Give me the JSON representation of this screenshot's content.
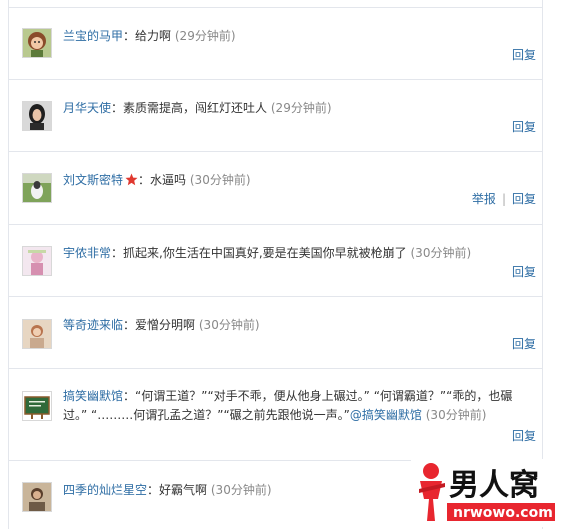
{
  "colors": {
    "link": "#2e6da4",
    "text": "#333333",
    "time": "#888888",
    "border": "#e3e6ec",
    "logo_red": "#e8262f"
  },
  "comments": [
    {
      "user": "兰宝的马甲",
      "text": "给力啊",
      "time": "(29分钟前)",
      "actions": [
        "回复"
      ],
      "avatar_icon": "cartoon-girl-avatar"
    },
    {
      "user": "月华天使",
      "text": "素质需提高，闯红灯还吐人",
      "time": "(29分钟前)",
      "actions": [
        "回复"
      ],
      "avatar_icon": "woman-photo-avatar"
    },
    {
      "user": "刘文斯密特",
      "badge_icon": "red-star-badge-icon",
      "text": "水逼吗",
      "time": "(30分钟前)",
      "actions": [
        "举报",
        "回复"
      ],
      "avatar_icon": "dog-on-grass-avatar"
    },
    {
      "user": "宇侬非常",
      "text": "抓起来,你生活在中国真好,要是在美国你早就被枪崩了",
      "time": "(30分钟前)",
      "actions": [
        "回复"
      ],
      "avatar_icon": "pink-figure-avatar"
    },
    {
      "user": "等奇迹来临",
      "text": "爱憎分明啊",
      "time": "(30分钟前)",
      "actions": [
        "回复"
      ],
      "avatar_icon": "girl-photo-avatar"
    },
    {
      "user": "搞笑幽默馆",
      "text": "“何谓王道？”“对手不乖，便从他身上碾过。” “何谓霸道？”“乖的，也碾过。” “………何谓孔孟之道？”“碾之前先跟他说一声。”",
      "mention": "@搞笑幽默馆",
      "time": "(30分钟前)",
      "actions": [
        "回复"
      ],
      "avatar_icon": "chalkboard-avatar"
    },
    {
      "user": "四季的灿烂星空",
      "text": "好霸气啊",
      "time": "(30分钟前)",
      "actions": [],
      "avatar_icon": "person-photo-avatar"
    }
  ],
  "watermark": {
    "brand": "男人窝",
    "url": "nrwowo.com"
  }
}
